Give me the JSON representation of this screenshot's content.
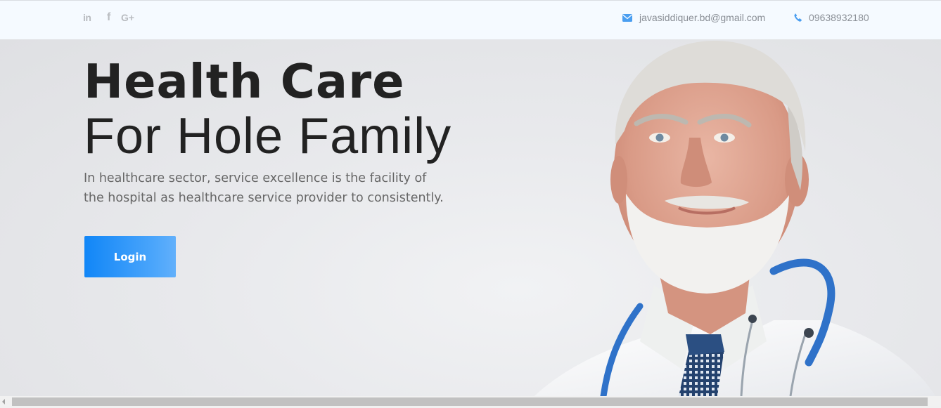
{
  "topbar": {
    "social": [
      {
        "icon": "linkedin-icon",
        "glyph": "in"
      },
      {
        "icon": "facebook-icon",
        "glyph": "f"
      },
      {
        "icon": "google-plus-icon",
        "glyph": "G+"
      }
    ],
    "email": {
      "icon": "envelope-icon",
      "text": "javasiddiquer.bd@gmail.com"
    },
    "phone": {
      "icon": "phone-icon",
      "text": "09638932180"
    }
  },
  "hero": {
    "title_bold": "Health Care",
    "title_light": "For Hole Family",
    "description_line1": "In healthcare sector, service excellence is the facility of",
    "description_line2": "the hospital as healthcare service provider to consistently.",
    "login_label": "Login",
    "image": "doctor-photo"
  },
  "colors": {
    "accent": "#1186f7",
    "icon_blue": "#4a9ef0",
    "topbar_bg": "#f5faff",
    "heading": "#222222",
    "body_text": "#666666"
  }
}
